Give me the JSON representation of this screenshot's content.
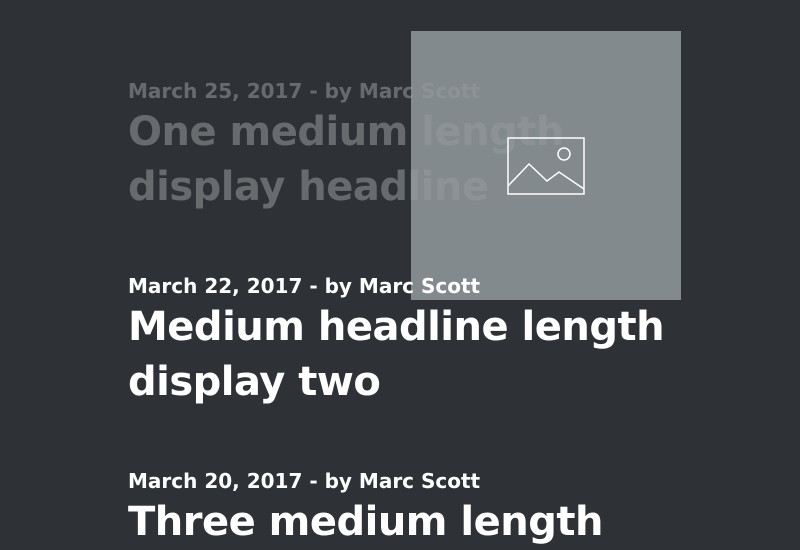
{
  "posts": [
    {
      "meta": "March 25, 2017 - by Marc Scott",
      "title_line1": "One medium length",
      "title_line2": "display headline"
    },
    {
      "meta": "March 22, 2017 - by Marc Scott",
      "title_line1": "Medium headline length",
      "title_line2": "display two"
    },
    {
      "meta": "March 20, 2017 - by Marc Scott",
      "title_line1": "Three medium length",
      "title_line2": ""
    }
  ],
  "image_placeholder": {
    "icon": "image-icon"
  },
  "colors": {
    "background": "#2e3236",
    "text": "#ffffff",
    "placeholder": "#8b9195"
  }
}
